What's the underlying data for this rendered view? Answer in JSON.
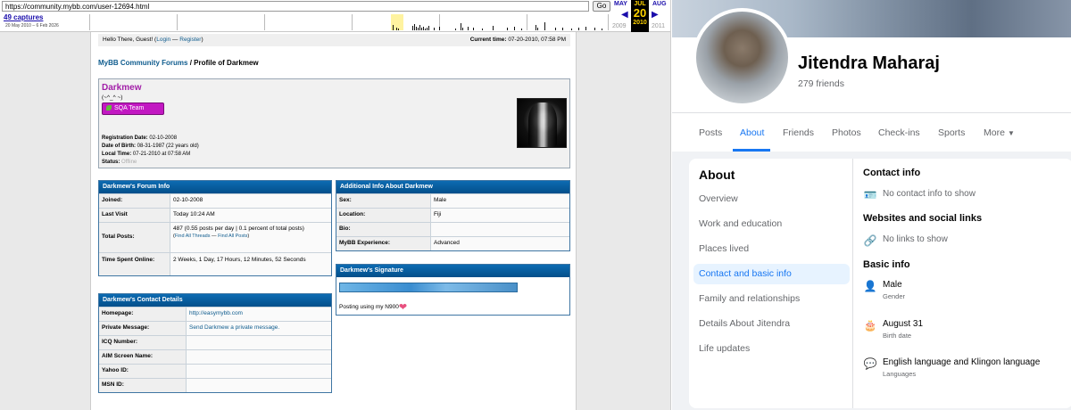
{
  "wayback": {
    "url": "https://community.mybb.com/user-12694.html",
    "go_label": "Go",
    "captures": "49 captures",
    "range": "20 May 2010 – 6 Feb 2026",
    "months": [
      "MAY",
      "JUL",
      "AUG"
    ],
    "day": "20",
    "years": [
      "2009",
      "2010",
      "2011"
    ]
  },
  "mybb": {
    "welcome": {
      "prefix": "Hello There, Guest! (",
      "login": "Login",
      "sep": " — ",
      "register": "Register",
      "suffix": ")"
    },
    "current_time_label": "Current time:",
    "current_time": "07-20-2010, 07:58 PM",
    "breadcrumb_root": "MyBB Community Forums",
    "breadcrumb_sep": "/",
    "breadcrumb_current": "Profile of Darkmew",
    "profile": {
      "username": "Darkmew",
      "usertitle": "(~^_^ ~)",
      "usergroup": "SQA Team",
      "details": [
        {
          "label": "Registration Date:",
          "value": "02-10-2008"
        },
        {
          "label": "Date of Birth:",
          "value": "08-31-1987 (22 years old)"
        },
        {
          "label": "Local Time:",
          "value": "07-21-2010 at 07:58 AM"
        },
        {
          "label": "Status:",
          "value": "Offline"
        }
      ]
    },
    "forum_info": {
      "title": "Darkmew's Forum Info",
      "joined_label": "Joined:",
      "joined": "02-10-2008",
      "lastvisit_label": "Last Visit",
      "lastvisit": "Today 10:24 AM",
      "posts_label": "Total Posts:",
      "posts": "487 (0.55 posts per day | 0.1 percent of total posts)",
      "find_threads": "Find All Threads",
      "find_posts": "Find All Posts",
      "time_label": "Time Spent Online:",
      "time": "2 Weeks, 1 Day, 17 Hours, 12 Minutes, 52 Seconds"
    },
    "contact": {
      "title": "Darkmew's Contact Details",
      "rows": [
        {
          "label": "Homepage:",
          "value": "http://easymybb.com",
          "link": true
        },
        {
          "label": "Private Message:",
          "value": "Send Darkmew a private message.",
          "link": true
        },
        {
          "label": "ICQ Number:",
          "value": ""
        },
        {
          "label": "AIM Screen Name:",
          "value": ""
        },
        {
          "label": "Yahoo ID:",
          "value": ""
        },
        {
          "label": "MSN ID:",
          "value": ""
        }
      ]
    },
    "additional": {
      "title": "Additional Info About Darkmew",
      "rows": [
        {
          "label": "Sex:",
          "value": "Male"
        },
        {
          "label": "Location:",
          "value": "Fiji"
        },
        {
          "label": "Bio:",
          "value": ""
        },
        {
          "label": "MyBB Experience:",
          "value": "Advanced"
        }
      ]
    },
    "signature": {
      "title": "Darkmew's Signature",
      "text": "Posting using my N900"
    }
  },
  "facebook": {
    "name": "Jitendra Maharaj",
    "friends": "279 friends",
    "tabs": [
      "Posts",
      "About",
      "Friends",
      "Photos",
      "Check-ins",
      "Sports",
      "More"
    ],
    "active_tab": "About",
    "about_heading": "About",
    "about_nav": [
      "Overview",
      "Work and education",
      "Places lived",
      "Contact and basic info",
      "Family and relationships",
      "Details About Jitendra",
      "Life updates"
    ],
    "active_nav": "Contact and basic info",
    "contact_heading": "Contact info",
    "contact_empty": "No contact info to show",
    "websites_heading": "Websites and social links",
    "websites_empty": "No links to show",
    "basic_heading": "Basic info",
    "basic": [
      {
        "value": "Male",
        "label": "Gender",
        "icon": "person-icon"
      },
      {
        "value": "August 31",
        "label": "Birth date",
        "icon": "cake-icon"
      },
      {
        "value": "English language and Klingon language",
        "label": "Languages",
        "icon": "speech-bubble-icon"
      }
    ]
  }
}
